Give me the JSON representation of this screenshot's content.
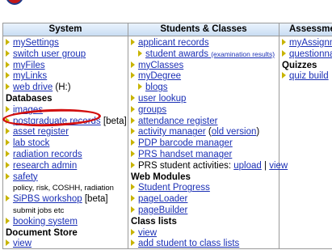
{
  "colors": {
    "link": "#1a2fb5",
    "bullet": "#c8b400",
    "highlight": "#d20f0f"
  },
  "headers": {
    "system": "System",
    "students": "Students & Classes",
    "assessment": "Assessme"
  },
  "system": {
    "items": [
      {
        "type": "link",
        "label": "mySettings"
      },
      {
        "type": "link",
        "label": "switch user group"
      },
      {
        "type": "link",
        "label": "myFiles"
      },
      {
        "type": "link",
        "label": "myLinks"
      },
      {
        "type": "link",
        "label": "web drive",
        "suffix": "(H:)"
      },
      {
        "type": "section",
        "label": "Databases"
      },
      {
        "type": "link",
        "label": "images"
      },
      {
        "type": "link",
        "label": "postgraduate records",
        "suffix": "[beta]"
      },
      {
        "type": "link",
        "label": "asset register"
      },
      {
        "type": "link",
        "label": "lab stock"
      },
      {
        "type": "link",
        "label": "radiation records"
      },
      {
        "type": "link",
        "label": "research admin"
      },
      {
        "type": "link",
        "label": "safety"
      },
      {
        "type": "note",
        "label": "policy, risk, COSHH, radiation"
      },
      {
        "type": "link",
        "label": "SiPBS workshop",
        "suffix": "[beta]"
      },
      {
        "type": "note",
        "label": "submit jobs etc"
      },
      {
        "type": "link",
        "label": "booking system"
      },
      {
        "type": "section",
        "label": "Document Store"
      },
      {
        "type": "link",
        "label": "view"
      }
    ]
  },
  "students": {
    "applicant_records": "applicant records",
    "student_awards": "student awards",
    "student_awards_note": "(examination results)",
    "myClasses": "myClasses",
    "myDegree": "myDegree",
    "blogs": "blogs",
    "user_lookup": "user lookup",
    "groups": "groups",
    "attendance_register": "attendance register",
    "activity_manager": "activity manager",
    "old_version": "old version",
    "pdp_barcode": "PDP barcode manager",
    "prs_handset": "PRS handset manager",
    "prs_activities_label": "PRS student activities:",
    "upload": "upload",
    "view": "view",
    "web_modules": "Web Modules",
    "student_progress": "Student Progress",
    "pageLoader": "pageLoader",
    "pageBuilder": "pageBuilder",
    "class_lists": "Class lists",
    "class_view": "view",
    "add_student": "add student to class lists"
  },
  "assessment": {
    "myAssignm": "myAssignm",
    "questionnai": "questionnai",
    "quizzes": "Quizzes",
    "quiz_build": "quiz build"
  }
}
